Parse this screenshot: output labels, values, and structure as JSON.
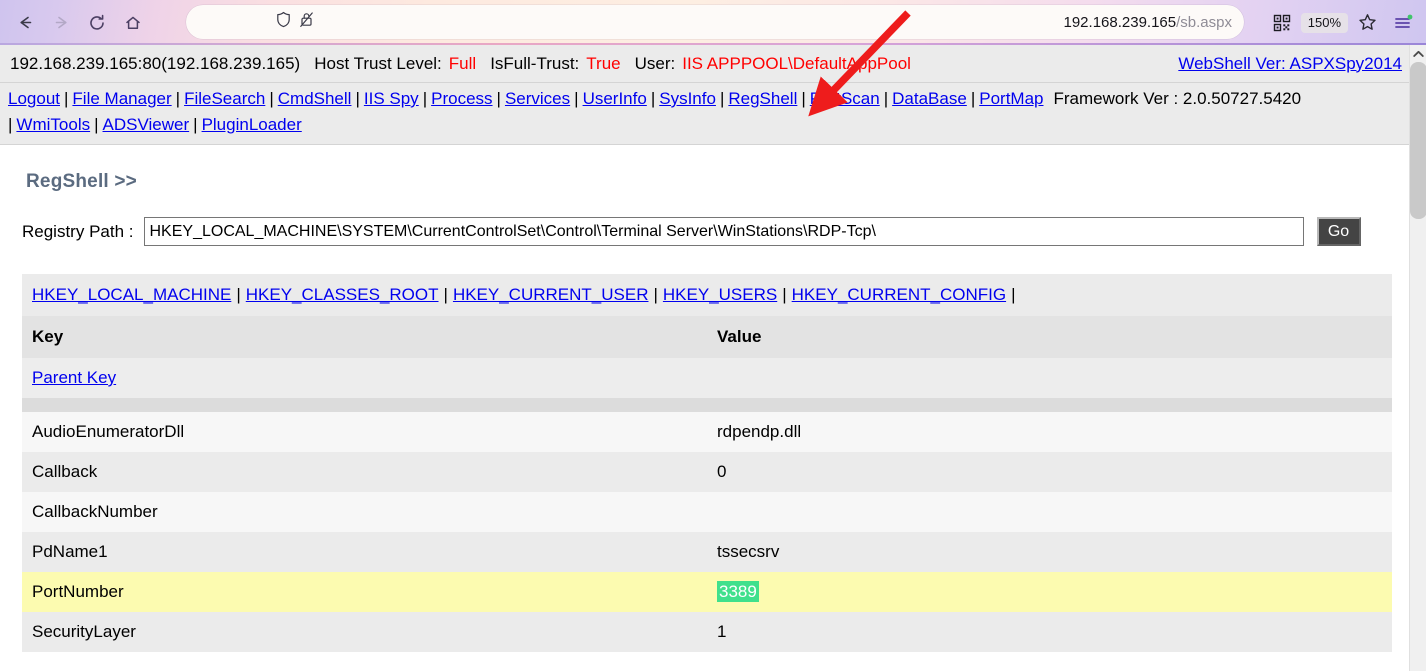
{
  "browser": {
    "nav": {
      "back_icon": "back-arrow-icon",
      "forward_icon": "forward-arrow-icon",
      "reload_icon": "reload-icon",
      "home_icon": "home-icon"
    },
    "address": {
      "host": "192.168.239.165",
      "path": "/sb.aspx",
      "shield_icon": "shield-icon",
      "broken_lock_icon": "broken-lock-icon"
    },
    "toolbar": {
      "qr_icon": "qr-code-icon",
      "zoom_level": "150%",
      "bookmark_icon": "star-icon",
      "menu_icon": "hamburger-menu-icon"
    }
  },
  "info_bar": {
    "server": "192.168.239.165:80(192.168.239.165)",
    "trust_label": "Host Trust Level:",
    "trust_value": "Full",
    "isfull_label": "IsFull-Trust:",
    "isfull_value": "True",
    "user_label": "User:",
    "user_value": "IIS APPPOOL\\DefaultAppPool",
    "webshell_ver": "WebShell Ver: ASPXSpy2014"
  },
  "nav_links": {
    "items": [
      "Logout",
      "File Manager",
      "FileSearch",
      "CmdShell",
      "IIS Spy",
      "Process",
      "Services",
      "UserInfo",
      "SysInfo",
      "RegShell",
      "PortScan",
      "DataBase",
      "PortMap"
    ],
    "second_row": [
      "WmiTools",
      "ADSViewer",
      "PluginLoader"
    ],
    "framework_ver": "Framework Ver : 2.0.50727.5420",
    "separator": "|"
  },
  "regshell": {
    "title": "RegShell >>",
    "path_label": "Registry Path :",
    "path_value": "HKEY_LOCAL_MACHINE\\SYSTEM\\CurrentControlSet\\Control\\Terminal Server\\WinStations\\RDP-Tcp\\",
    "path_placeholder": "Registry Path",
    "go_label": "Go"
  },
  "hives": [
    "HKEY_LOCAL_MACHINE",
    "HKEY_CLASSES_ROOT",
    "HKEY_CURRENT_USER",
    "HKEY_USERS",
    "HKEY_CURRENT_CONFIG"
  ],
  "table": {
    "headers": {
      "key": "Key",
      "value": "Value"
    },
    "parent_key_label": "Parent Key",
    "rows": [
      {
        "key": "AudioEnumeratorDll",
        "value": "rdpendp.dll",
        "highlight": false,
        "selected": false
      },
      {
        "key": "Callback",
        "value": "0",
        "highlight": false,
        "selected": false
      },
      {
        "key": "CallbackNumber",
        "value": "",
        "highlight": false,
        "selected": false
      },
      {
        "key": "PdName1",
        "value": "tssecsrv",
        "highlight": false,
        "selected": false
      },
      {
        "key": "PortNumber",
        "value": "3389",
        "highlight": true,
        "selected": true
      },
      {
        "key": "SecurityLayer",
        "value": "1",
        "highlight": false,
        "selected": false
      }
    ]
  },
  "annotation": {
    "arrow_color": "#ee1c1c",
    "arrow_target": "RegShell"
  },
  "colors": {
    "link": "#0000ee",
    "red_value": "#ff0000",
    "row_highlight": "#fcfbb0",
    "selection_green": "#3fe08c",
    "title_gray": "#5b6b80"
  }
}
